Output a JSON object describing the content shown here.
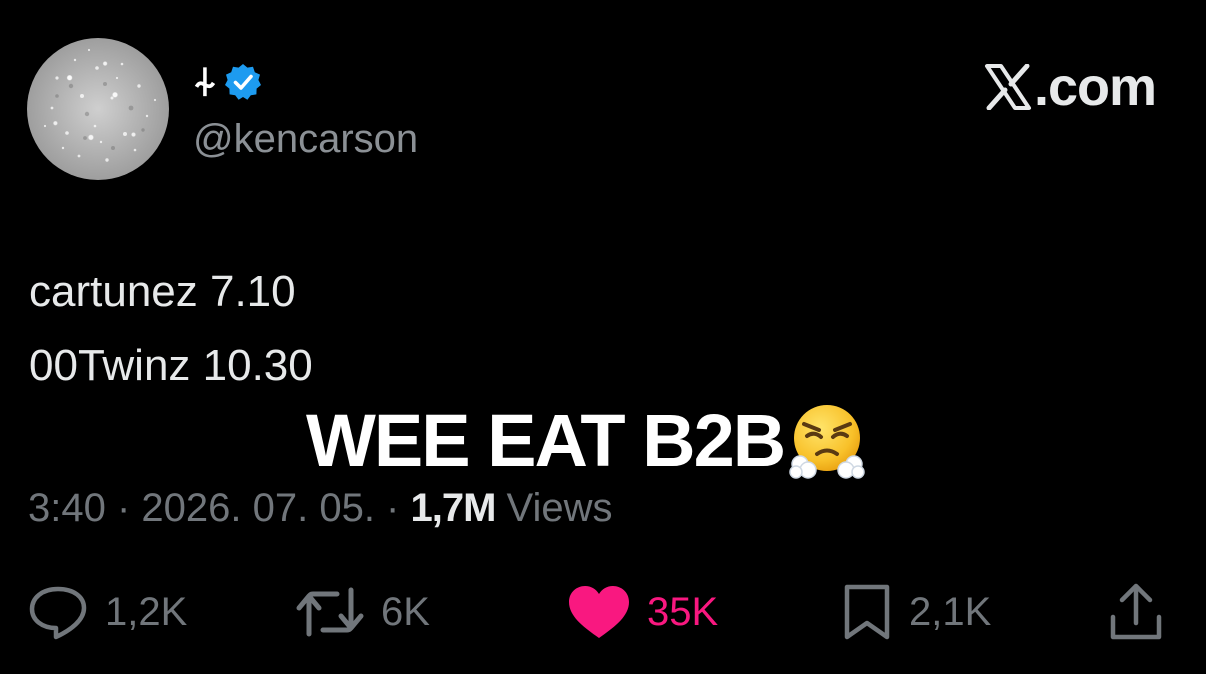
{
  "author": {
    "display_name": "⍭",
    "handle": "@kencarson",
    "verified": true
  },
  "brand": {
    "label": ".com"
  },
  "tweet": {
    "lines": [
      "cartunez 7.10",
      "00Twinz 10.30"
    ]
  },
  "overlay": {
    "text": "WEE EAT B2B",
    "emoji_name": "face-with-steam-from-nose-emoji"
  },
  "meta": {
    "time": "3:40 · 2026. 07. 05. · ",
    "views_count": "1,7M",
    "views_label": " Views"
  },
  "actions": {
    "replies": "1,2K",
    "reposts": "6K",
    "likes": "35K",
    "bookmarks": "2,1K"
  },
  "colors": {
    "background": "#000000",
    "verified_blue": "#1d9bf0",
    "like_pink": "#f91880",
    "muted_gray": "#71767b"
  }
}
